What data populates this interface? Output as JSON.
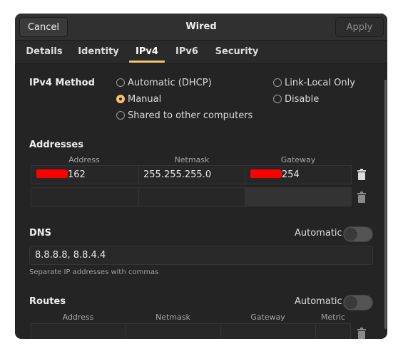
{
  "header": {
    "title": "Wired",
    "cancel_label": "Cancel",
    "apply_label": "Apply"
  },
  "tabs": [
    {
      "label": "Details",
      "active": false
    },
    {
      "label": "Identity",
      "active": false
    },
    {
      "label": "IPv4",
      "active": true
    },
    {
      "label": "IPv6",
      "active": false
    },
    {
      "label": "Security",
      "active": false
    }
  ],
  "ipv4_method": {
    "label": "IPv4 Method",
    "selected": "Manual",
    "options": [
      {
        "label": "Automatic (DHCP)",
        "checked": false
      },
      {
        "label": "Manual",
        "checked": true
      },
      {
        "label": "Shared to other computers",
        "checked": false
      },
      {
        "label": "Link-Local Only",
        "checked": false
      },
      {
        "label": "Disable",
        "checked": false
      }
    ]
  },
  "addresses": {
    "title": "Addresses",
    "columns": [
      "Address",
      "Netmask",
      "Gateway"
    ],
    "rows": [
      {
        "address": "162",
        "address_redacted": true,
        "netmask": "255.255.255.0",
        "gateway": "254",
        "gateway_redacted": true
      },
      {
        "address": "",
        "netmask": "",
        "gateway": ""
      }
    ]
  },
  "dns": {
    "title": "DNS",
    "automatic_label": "Automatic",
    "automatic": false,
    "value": "8.8.8.8, 8.8.4.4",
    "hint": "Separate IP addresses with commas"
  },
  "routes": {
    "title": "Routes",
    "automatic_label": "Automatic",
    "automatic": false,
    "columns": [
      "Address",
      "Netmask",
      "Gateway",
      "Metric"
    ],
    "rows": [
      {
        "address": "",
        "netmask": "",
        "gateway": "",
        "metric": ""
      }
    ]
  },
  "colors": {
    "accent": "#f5c26b",
    "window_bg": "#242424",
    "headerbar_bg": "#303030",
    "redaction": "#ff0000"
  }
}
